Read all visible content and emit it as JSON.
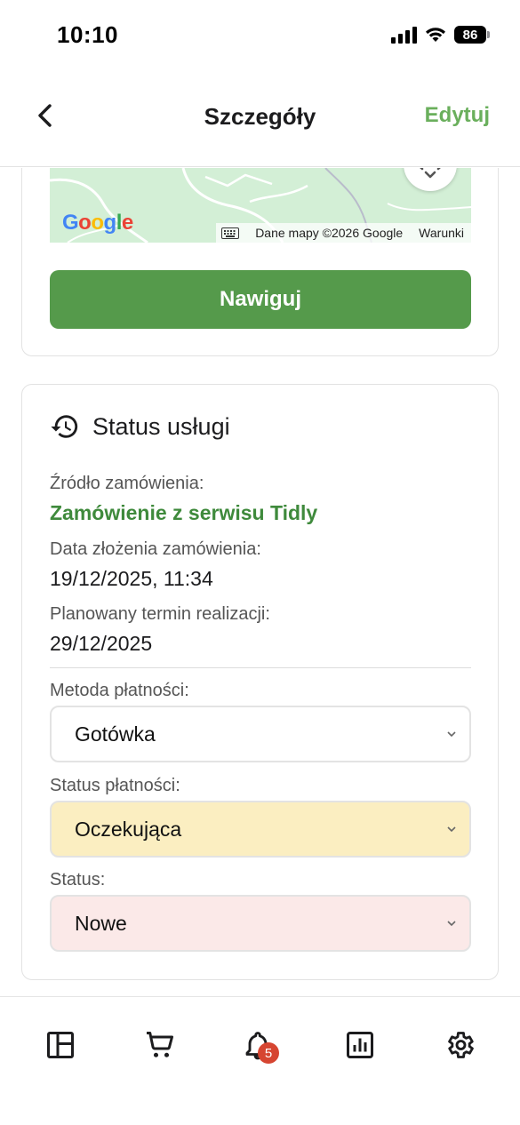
{
  "status_bar": {
    "time": "10:10",
    "battery": "86"
  },
  "navbar": {
    "title": "Szczegóły",
    "edit_label": "Edytuj"
  },
  "map": {
    "logo": "Google",
    "attribution": "Dane mapy ©2026 Google",
    "terms": "Warunki"
  },
  "navigate_label": "Nawiguj",
  "service_status": {
    "title": "Status usługi",
    "source_label": "Źródło zamówienia:",
    "source_value": "Zamówienie z serwisu Tidly",
    "date_label": "Data złożenia zamówienia:",
    "date_value": "19/12/2025, 11:34",
    "planned_label": "Planowany termin realizacji:",
    "planned_value": "29/12/2025",
    "payment_method_label": "Metoda płatności:",
    "payment_method_value": "Gotówka",
    "payment_status_label": "Status płatności:",
    "payment_status_value": "Oczekująca",
    "status_label": "Status:",
    "status_value": "Nowe"
  },
  "tabbar": {
    "notifications_badge": "5"
  },
  "colors": {
    "accent_green": "#559a4b",
    "edit_green": "#6aaf5c",
    "source_green": "#3f8a3c",
    "pending_yellow": "#fbeec1",
    "new_pink": "#fbe9e8",
    "badge_red": "#d64531"
  },
  "icons": [
    "chevron-left-icon",
    "fullscreen-icon",
    "keyboard-icon",
    "history-icon",
    "chevron-down-icon",
    "dashboard-icon",
    "cart-icon",
    "bell-icon",
    "chart-icon",
    "gear-icon"
  ]
}
